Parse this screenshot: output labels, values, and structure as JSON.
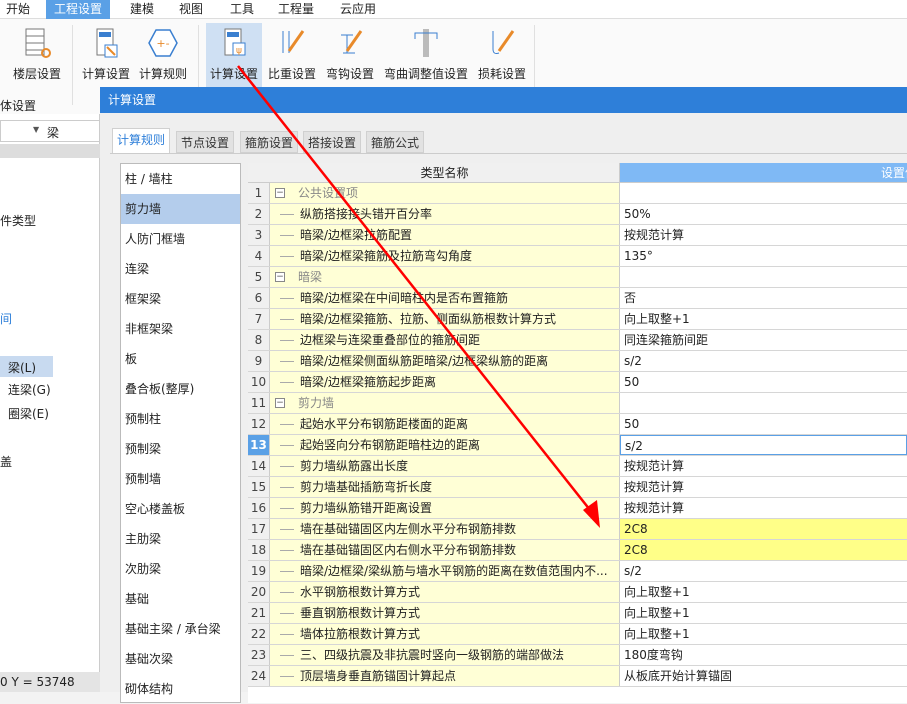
{
  "menu": [
    "开始",
    "工程设置",
    "建模",
    "视图",
    "工具",
    "工程量",
    "云应用"
  ],
  "ribbon": {
    "buttons": [
      "楼层设置",
      "计算设置",
      "计算规则",
      "计算设置",
      "比重设置",
      "弯钩设置",
      "弯曲调整值设置",
      "损耗设置"
    ],
    "group_label": "体设置",
    "partial_left": "〕"
  },
  "left_panel": {
    "dropdown_value": "梁",
    "tree": [
      "件类型",
      "间",
      "梁(L)",
      "连梁(G)",
      "圈梁(E)",
      "盖"
    ],
    "status": "0 Y = 53748"
  },
  "dialog": {
    "title": "计算设置",
    "tabs": [
      "计算规则",
      "节点设置",
      "箍筋设置",
      "搭接设置",
      "箍筋公式"
    ],
    "categories": [
      "柱 / 墙柱",
      "剪力墙",
      "人防门框墙",
      "连梁",
      "框架梁",
      "非框架梁",
      "板",
      "叠合板(整厚)",
      "预制柱",
      "预制梁",
      "预制墙",
      "空心楼盖板",
      "主肋梁",
      "次肋梁",
      "基础",
      "基础主梁 / 承台梁",
      "基础次梁",
      "砌体结构"
    ],
    "selected_category": "剪力墙",
    "grid": {
      "headers": [
        "类型名称",
        "设置值"
      ],
      "rows": [
        {
          "n": "1",
          "name": "公共设置项",
          "value": "",
          "group": true
        },
        {
          "n": "2",
          "name": "纵筋搭接接头错开百分率",
          "value": "50%"
        },
        {
          "n": "3",
          "name": "暗梁/边框梁拉筋配置",
          "value": "按规范计算"
        },
        {
          "n": "4",
          "name": "暗梁/边框梁箍筋及拉筋弯勾角度",
          "value": "135°"
        },
        {
          "n": "5",
          "name": "暗梁",
          "value": "",
          "group": true
        },
        {
          "n": "6",
          "name": "暗梁/边框梁在中间暗柱内是否布置箍筋",
          "value": "否"
        },
        {
          "n": "7",
          "name": "暗梁/边框梁箍筋、拉筋、侧面纵筋根数计算方式",
          "value": "向上取整+1"
        },
        {
          "n": "8",
          "name": "边框梁与连梁重叠部位的箍筋间距",
          "value": "同连梁箍筋间距"
        },
        {
          "n": "9",
          "name": "暗梁/边框梁侧面纵筋距暗梁/边框梁纵筋的距离",
          "value": "s/2"
        },
        {
          "n": "10",
          "name": "暗梁/边框梁箍筋起步距离",
          "value": "50"
        },
        {
          "n": "11",
          "name": "剪力墙",
          "value": "",
          "group": true
        },
        {
          "n": "12",
          "name": "起始水平分布钢筋距楼面的距离",
          "value": "50"
        },
        {
          "n": "13",
          "name": "起始竖向分布钢筋距暗柱边的距离",
          "value": "s/2",
          "selected": true
        },
        {
          "n": "14",
          "name": "剪力墙纵筋露出长度",
          "value": "按规范计算"
        },
        {
          "n": "15",
          "name": "剪力墙基础插筋弯折长度",
          "value": "按规范计算"
        },
        {
          "n": "16",
          "name": "剪力墙纵筋错开距离设置",
          "value": "按规范计算"
        },
        {
          "n": "17",
          "name": "墙在基础锚固区内左侧水平分布钢筋排数",
          "value": "2C8",
          "highlight": true
        },
        {
          "n": "18",
          "name": "墙在基础锚固区内右侧水平分布钢筋排数",
          "value": "2C8",
          "highlight": true
        },
        {
          "n": "19",
          "name": "暗梁/边框梁/梁纵筋与墙水平钢筋的距离在数值范围内不...",
          "value": "s/2"
        },
        {
          "n": "20",
          "name": "水平钢筋根数计算方式",
          "value": "向上取整+1"
        },
        {
          "n": "21",
          "name": "垂直钢筋根数计算方式",
          "value": "向上取整+1"
        },
        {
          "n": "22",
          "name": "墙体拉筋根数计算方式",
          "value": "向上取整+1"
        },
        {
          "n": "23",
          "name": "三、四级抗震及非抗震时竖向一级钢筋的端部做法",
          "value": "180度弯钩"
        },
        {
          "n": "24",
          "name": "顶层墙身垂直筋锚固计算起点",
          "value": "从板底开始计算锚固"
        }
      ]
    }
  },
  "colors": {
    "accent": "#2e7fd9",
    "header_blue": "#7fb9f5",
    "highlight": "#ffff88",
    "name_bg": "#ffffd6",
    "annotation": "#ff0000"
  }
}
